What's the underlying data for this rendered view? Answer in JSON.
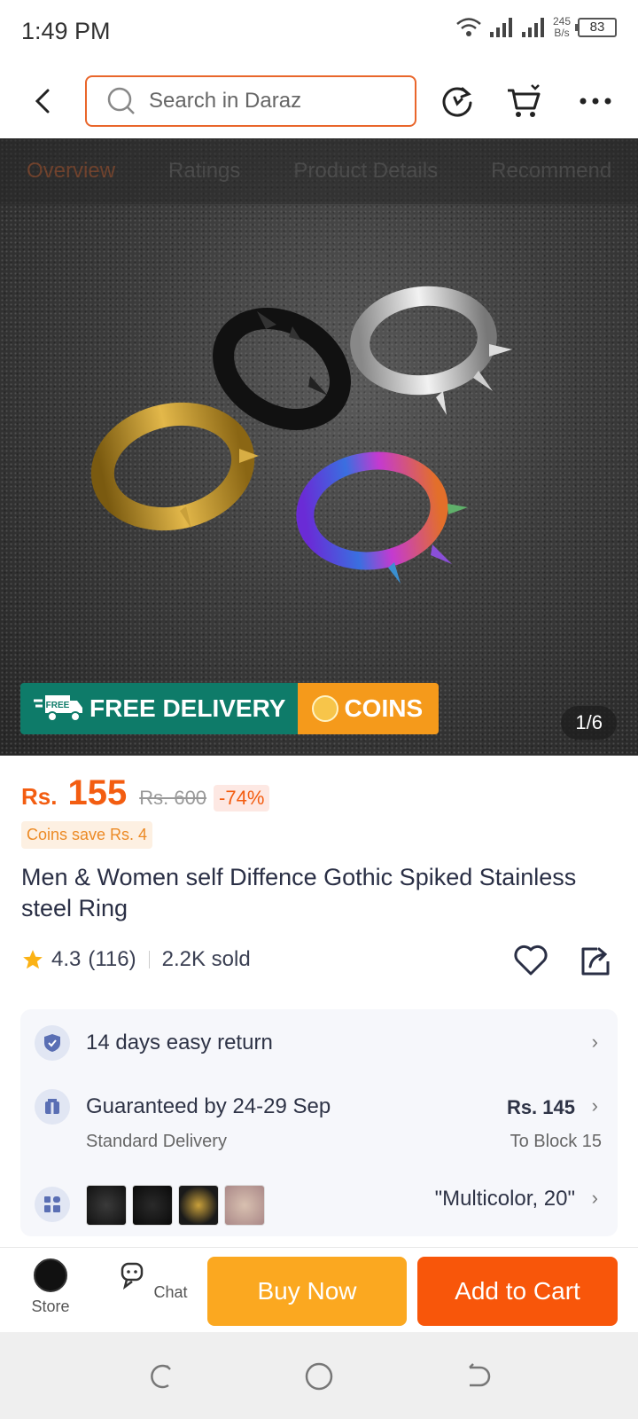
{
  "status": {
    "time": "1:49 PM",
    "speed_value": "245",
    "speed_unit": "B/s",
    "battery": "83"
  },
  "nav": {
    "search_placeholder": "Search in Daraz"
  },
  "gallery": {
    "tabs": [
      "Overview",
      "Ratings",
      "Product Details",
      "Recommend"
    ],
    "promo_free": "FREE DELIVERY",
    "promo_free_badge": "FREE",
    "promo_coins": "COINS",
    "page_counter": "1/6"
  },
  "product": {
    "currency": "Rs.",
    "price": "155",
    "old_price": "Rs. 600",
    "discount": "-74%",
    "coins_save": "Coins save Rs. 4",
    "title": "Men & Women self Diffence Gothic Spiked Stainless steel Ring",
    "rating": "4.3",
    "rating_count": "(116)",
    "sold": "2.2K sold"
  },
  "info": {
    "return_text": "14 days easy return",
    "delivery_text": "Guaranteed by 24-29 Sep",
    "delivery_sub": "Standard Delivery",
    "delivery_price": "Rs. 145",
    "delivery_dest": "To Block 15",
    "variant_text": "\"Multicolor, 20\""
  },
  "actions": {
    "store": "Store",
    "chat": "Chat",
    "buy_now": "Buy Now",
    "add_to_cart": "Add to Cart"
  },
  "colors": {
    "accent": "#f8560a",
    "buy_now": "#fba820",
    "free_delivery": "#0e7b69",
    "coins": "#f59a1b"
  }
}
